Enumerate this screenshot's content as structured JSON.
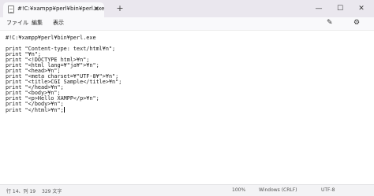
{
  "tab": {
    "title": "#!C:¥xampp¥perl¥bin¥perl.exe",
    "close": "✕"
  },
  "new_tab": "+",
  "window_controls": {
    "minimize": "—",
    "maximize": "☐",
    "close": "✕"
  },
  "menu": {
    "file": "ファイル",
    "edit": "編集",
    "view": "表示"
  },
  "toolbar": {
    "spellcheck_icon": "✎",
    "settings_icon": "⚙"
  },
  "editor": {
    "lines": [
      "#!C:¥xampp¥perl¥bin¥perl.exe",
      "",
      "print \"Content-type: text/html¥n\";",
      "print \"¥n\";",
      "print \"<!DOCTYPE html>¥n\";",
      "print \"<html lang=¥\"ja¥\">¥n\";",
      "print \"<head>¥n\";",
      "print \"<meta charset=¥\"UTF-8¥\">¥n\";",
      "print \"<title>CGI Sample</title>¥n\";",
      "print \"</head>¥n\";",
      "print \"<body>¥n\";",
      "print \"<p>Hello XAMPP</p>¥n\";",
      "print \"</body>¥n\";",
      "print \"</html>¥n\";"
    ]
  },
  "status": {
    "position": "行 14、列 19",
    "char_count": "329 文字",
    "zoom": "100%",
    "line_ending": "Windows (CRLF)",
    "encoding": "UTF-8"
  }
}
